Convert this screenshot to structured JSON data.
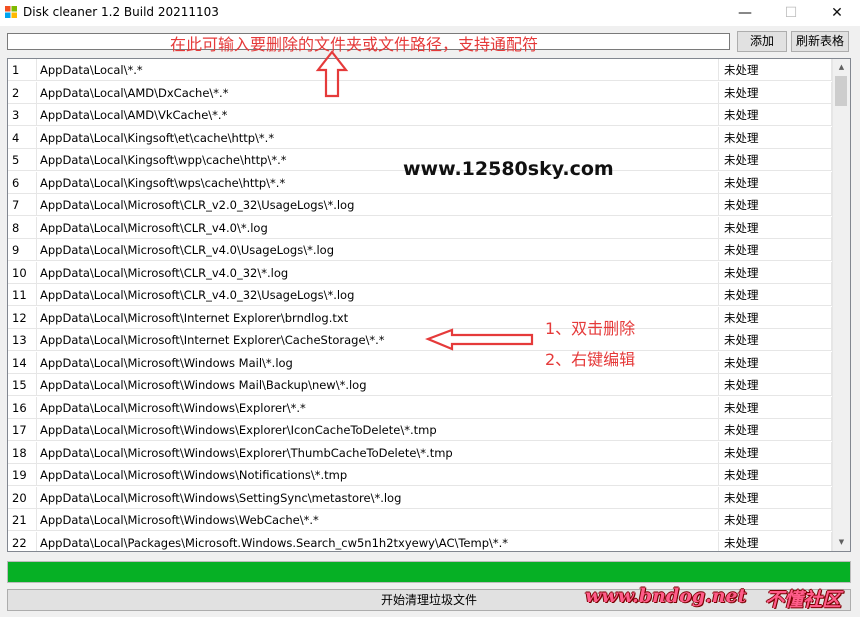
{
  "window": {
    "title": "Disk cleaner 1.2 Build 20211103",
    "controls": {
      "minimize": "—",
      "maximize": "☐",
      "close": "✕"
    }
  },
  "toolbar": {
    "path_input_value": "",
    "add_label": "添加",
    "refresh_label": "刷新表格"
  },
  "table": {
    "rows": [
      {
        "num": "1",
        "path": "AppData\\Local\\*.*",
        "status": "未处理"
      },
      {
        "num": "2",
        "path": "AppData\\Local\\AMD\\DxCache\\*.*",
        "status": "未处理"
      },
      {
        "num": "3",
        "path": "AppData\\Local\\AMD\\VkCache\\*.*",
        "status": "未处理"
      },
      {
        "num": "4",
        "path": "AppData\\Local\\Kingsoft\\et\\cache\\http\\*.*",
        "status": "未处理"
      },
      {
        "num": "5",
        "path": "AppData\\Local\\Kingsoft\\wpp\\cache\\http\\*.*",
        "status": "未处理"
      },
      {
        "num": "6",
        "path": "AppData\\Local\\Kingsoft\\wps\\cache\\http\\*.*",
        "status": "未处理"
      },
      {
        "num": "7",
        "path": "AppData\\Local\\Microsoft\\CLR_v2.0_32\\UsageLogs\\*.log",
        "status": "未处理"
      },
      {
        "num": "8",
        "path": "AppData\\Local\\Microsoft\\CLR_v4.0\\*.log",
        "status": "未处理"
      },
      {
        "num": "9",
        "path": "AppData\\Local\\Microsoft\\CLR_v4.0\\UsageLogs\\*.log",
        "status": "未处理"
      },
      {
        "num": "10",
        "path": "AppData\\Local\\Microsoft\\CLR_v4.0_32\\*.log",
        "status": "未处理"
      },
      {
        "num": "11",
        "path": "AppData\\Local\\Microsoft\\CLR_v4.0_32\\UsageLogs\\*.log",
        "status": "未处理"
      },
      {
        "num": "12",
        "path": "AppData\\Local\\Microsoft\\Internet Explorer\\brndlog.txt",
        "status": "未处理"
      },
      {
        "num": "13",
        "path": "AppData\\Local\\Microsoft\\Internet Explorer\\CacheStorage\\*.*",
        "status": "未处理"
      },
      {
        "num": "14",
        "path": "AppData\\Local\\Microsoft\\Windows Mail\\*.log",
        "status": "未处理"
      },
      {
        "num": "15",
        "path": "AppData\\Local\\Microsoft\\Windows Mail\\Backup\\new\\*.log",
        "status": "未处理"
      },
      {
        "num": "16",
        "path": "AppData\\Local\\Microsoft\\Windows\\Explorer\\*.*",
        "status": "未处理"
      },
      {
        "num": "17",
        "path": "AppData\\Local\\Microsoft\\Windows\\Explorer\\IconCacheToDelete\\*.tmp",
        "status": "未处理"
      },
      {
        "num": "18",
        "path": "AppData\\Local\\Microsoft\\Windows\\Explorer\\ThumbCacheToDelete\\*.tmp",
        "status": "未处理"
      },
      {
        "num": "19",
        "path": "AppData\\Local\\Microsoft\\Windows\\Notifications\\*.tmp",
        "status": "未处理"
      },
      {
        "num": "20",
        "path": "AppData\\Local\\Microsoft\\Windows\\SettingSync\\metastore\\*.log",
        "status": "未处理"
      },
      {
        "num": "21",
        "path": "AppData\\Local\\Microsoft\\Windows\\WebCache\\*.*",
        "status": "未处理"
      },
      {
        "num": "22",
        "path": "AppData\\Local\\Packages\\Microsoft.Windows.Search_cw5n1h2txyewy\\AC\\Temp\\*.*",
        "status": "未处理"
      }
    ]
  },
  "progress": {
    "fraction": 1.0,
    "color": "#06b025"
  },
  "clean_button_label": "开始清理垃圾文件",
  "annotations": {
    "input_hint": "在此可输入要删除的文件夹或文件路径，支持通配符",
    "step1": "1、双击删除",
    "step2": "2、右键编辑",
    "accent_color": "#e53a3a"
  },
  "watermarks": {
    "site": "www.12580sky.com",
    "bottom_site": "www.bndog.net",
    "bottom_name": "不懂社区"
  }
}
